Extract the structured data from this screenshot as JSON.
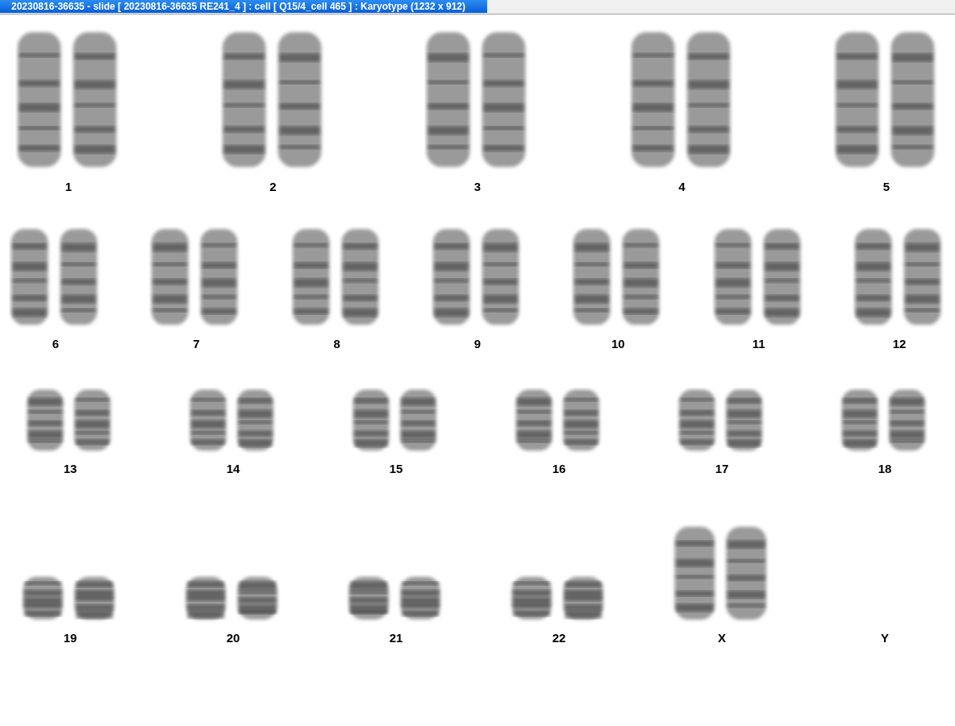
{
  "window": {
    "title": "20230816-36635 - slide [ 20230816-36635 RE241_4 ] : cell [ Q15/4_cell 465 ] : Karyotype  (1232 x 912)"
  },
  "karyotype": {
    "rows": [
      {
        "groups": [
          {
            "label": "1",
            "kind": "pair"
          },
          {
            "label": "2",
            "kind": "pair"
          },
          {
            "label": "3",
            "kind": "pair"
          },
          {
            "label": "4",
            "kind": "pair"
          },
          {
            "label": "5",
            "kind": "pair"
          }
        ]
      },
      {
        "groups": [
          {
            "label": "6",
            "kind": "pair"
          },
          {
            "label": "7",
            "kind": "pair"
          },
          {
            "label": "8",
            "kind": "pair"
          },
          {
            "label": "9",
            "kind": "pair"
          },
          {
            "label": "10",
            "kind": "pair"
          },
          {
            "label": "11",
            "kind": "pair"
          },
          {
            "label": "12",
            "kind": "pair"
          }
        ]
      },
      {
        "groups": [
          {
            "label": "13",
            "kind": "pair"
          },
          {
            "label": "14",
            "kind": "pair"
          },
          {
            "label": "15",
            "kind": "pair"
          },
          {
            "label": "16",
            "kind": "pair"
          },
          {
            "label": "17",
            "kind": "pair"
          },
          {
            "label": "18",
            "kind": "pair"
          }
        ]
      },
      {
        "groups": [
          {
            "label": "19",
            "kind": "pair"
          },
          {
            "label": "20",
            "kind": "pair"
          },
          {
            "label": "21",
            "kind": "pair"
          },
          {
            "label": "22",
            "kind": "pair"
          },
          {
            "label": "X",
            "kind": "pair"
          },
          {
            "label": "Y",
            "kind": "empty"
          }
        ]
      }
    ]
  }
}
